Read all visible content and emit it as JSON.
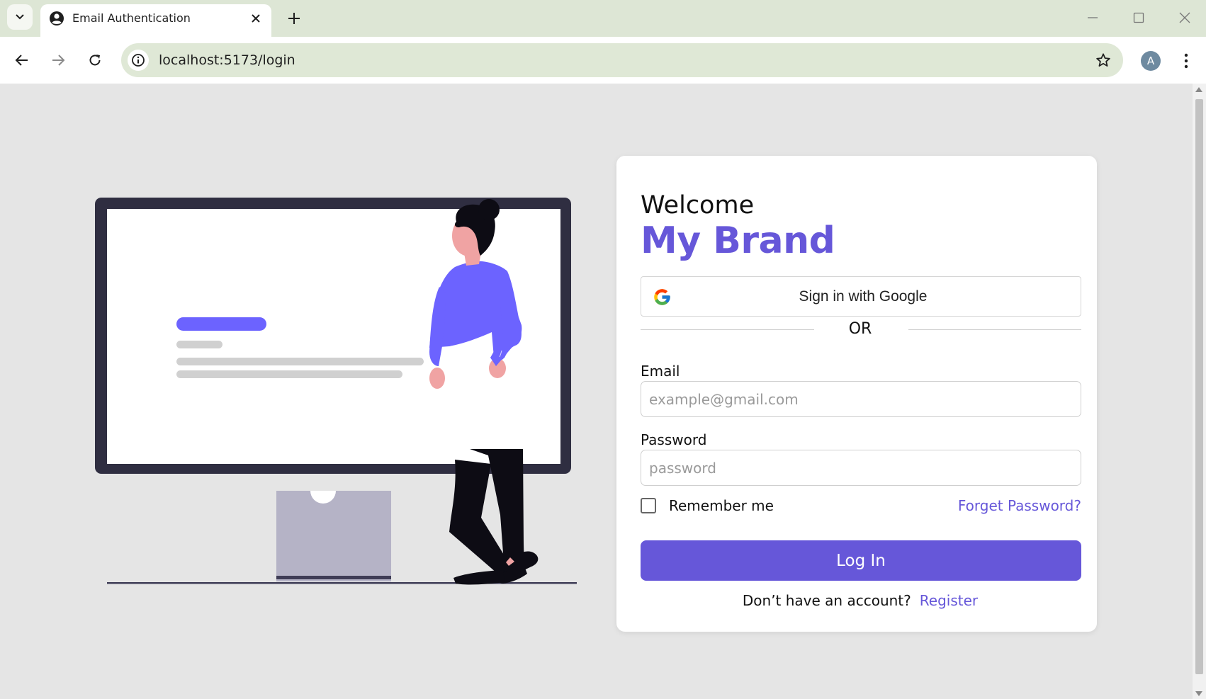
{
  "browser": {
    "tab_title": "Email Authentication",
    "url": "localhost:5173/login",
    "profile_initial": "A",
    "icons": {
      "tab_search": "chevron-down-icon",
      "favicon": "account-circle-icon",
      "tab_close": "close-icon",
      "new_tab": "plus-icon",
      "minimize": "minimize-icon",
      "maximize": "maximize-icon",
      "close_window": "close-icon",
      "back": "arrow-left-icon",
      "forward": "arrow-right-icon",
      "reload": "reload-icon",
      "site_info": "info-icon",
      "bookmark": "star-icon",
      "menu": "more-vert-icon"
    }
  },
  "login": {
    "welcome": "Welcome",
    "brand": "My Brand",
    "google_button": "Sign in with Google",
    "or_text": "OR",
    "email_label": "Email",
    "email_placeholder": "example@gmail.com",
    "password_label": "Password",
    "password_placeholder": "password",
    "remember_label": "Remember me",
    "remember_checked": false,
    "forgot_link": "Forget Password?",
    "login_button": "Log In",
    "no_account_text": "Don’t have an account?",
    "register_link": "Register"
  },
  "colors": {
    "brand": "#6657d9",
    "page_background": "#e5e5e5",
    "browser_frame": "#dde6d5"
  }
}
